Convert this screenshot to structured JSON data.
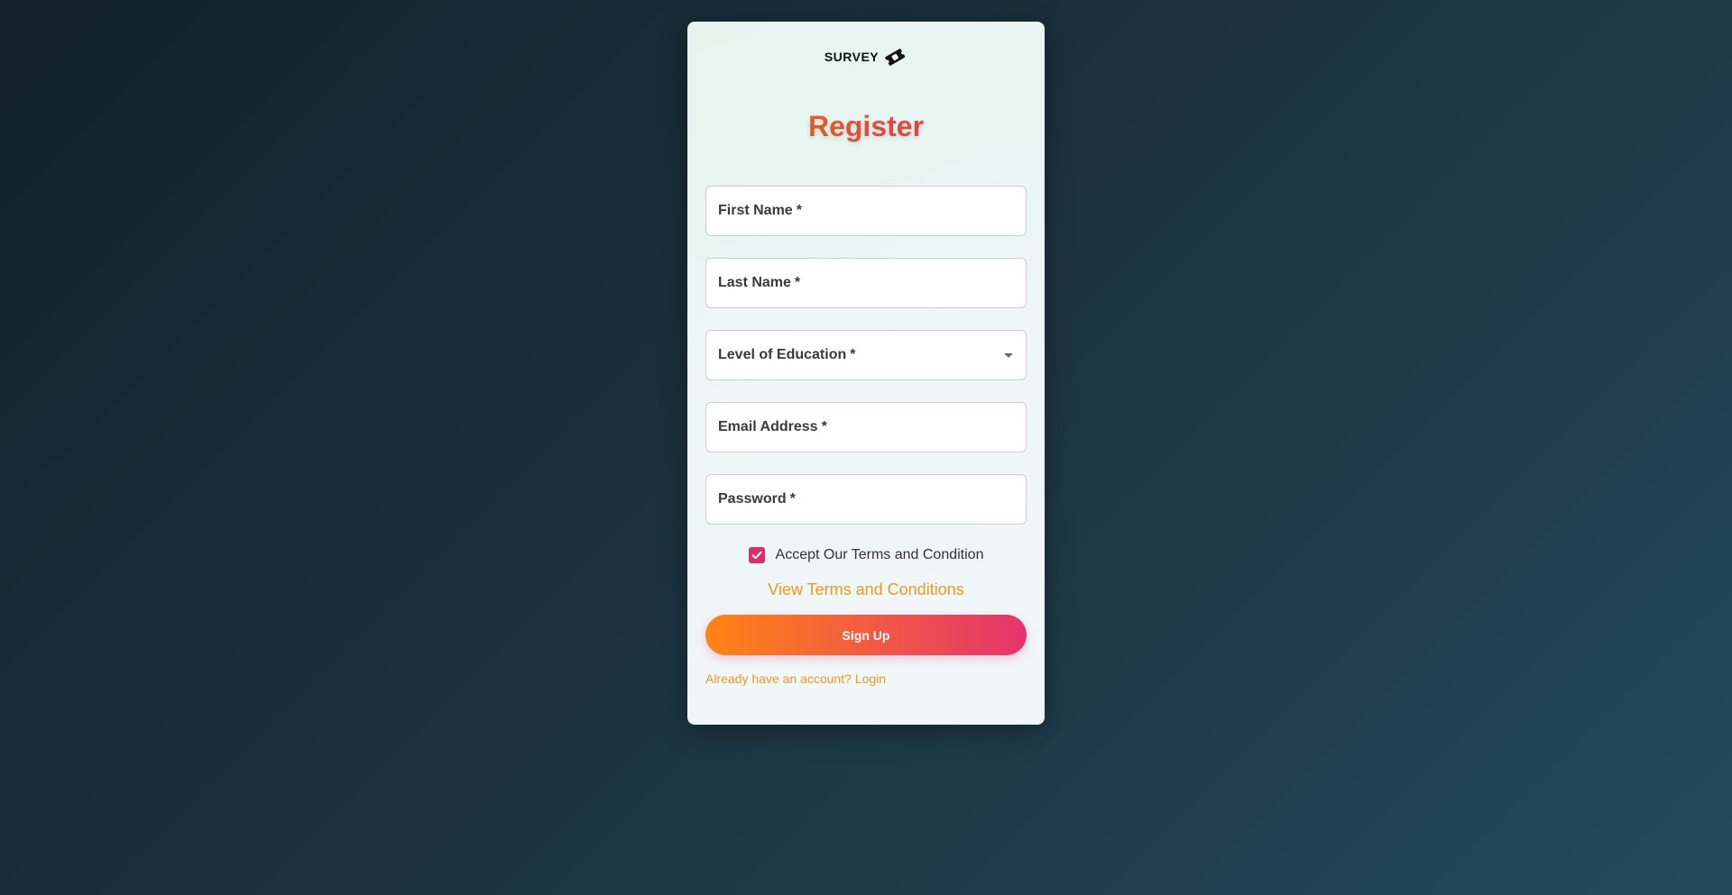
{
  "brand": {
    "name": "SURVEY",
    "icon": "ticket-icon"
  },
  "form": {
    "title": "Register",
    "fields": [
      {
        "label": "First Name",
        "required_mark": "*"
      },
      {
        "label": "Last Name",
        "required_mark": "*"
      },
      {
        "label": "Level of Education",
        "required_mark": "*"
      },
      {
        "label": "Email Address",
        "required_mark": "*"
      },
      {
        "label": "Password",
        "required_mark": "*"
      }
    ],
    "terms_checkbox_label": "Accept Our Terms and Condition",
    "terms_checked": true,
    "view_terms_link": "View Terms and Conditions",
    "submit_label": "Sign Up",
    "login_link": "Already have an account? Login"
  },
  "colors": {
    "accent_orange": "#f0981a",
    "accent_pink": "#e5336d",
    "checkbox": "#d8306a"
  }
}
